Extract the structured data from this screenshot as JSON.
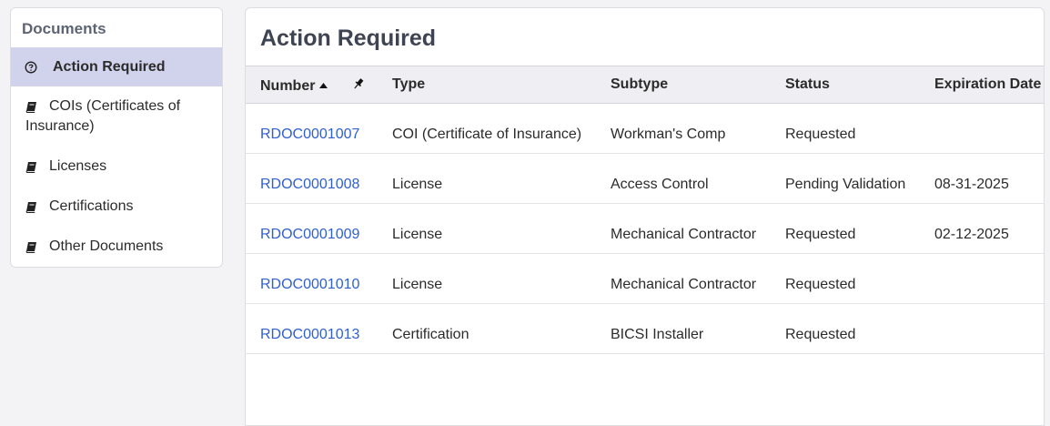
{
  "sidebar": {
    "title": "Documents",
    "items": [
      {
        "label": "Action Required",
        "icon": "question-circle-icon",
        "active": true
      },
      {
        "label": "COIs (Certificates of Insurance)",
        "icon": "book-icon",
        "active": false
      },
      {
        "label": "Licenses",
        "icon": "book-icon",
        "active": false
      },
      {
        "label": "Certifications",
        "icon": "book-icon",
        "active": false
      },
      {
        "label": "Other Documents",
        "icon": "book-icon",
        "active": false
      }
    ]
  },
  "main": {
    "title": "Action Required",
    "columns": {
      "number": "Number",
      "type": "Type",
      "subtype": "Subtype",
      "status": "Status",
      "expiration": "Expiration Date"
    },
    "rows": [
      {
        "number": "RDOC0001007",
        "type": "COI (Certificate of Insurance)",
        "subtype": "Workman's Comp",
        "status": "Requested",
        "expiration": ""
      },
      {
        "number": "RDOC0001008",
        "type": "License",
        "subtype": "Access Control",
        "status": "Pending Validation",
        "expiration": "08-31-2025"
      },
      {
        "number": "RDOC0001009",
        "type": "License",
        "subtype": "Mechanical Contractor",
        "status": "Requested",
        "expiration": "02-12-2025"
      },
      {
        "number": "RDOC0001010",
        "type": "License",
        "subtype": "Mechanical Contractor",
        "status": "Requested",
        "expiration": ""
      },
      {
        "number": "RDOC0001013",
        "type": "Certification",
        "subtype": "BICSI Installer",
        "status": "Requested",
        "expiration": ""
      }
    ]
  },
  "colors": {
    "link": "#2f5fd1",
    "active_nav_bg": "#d1d3ec",
    "header_bg": "#efeff3"
  }
}
